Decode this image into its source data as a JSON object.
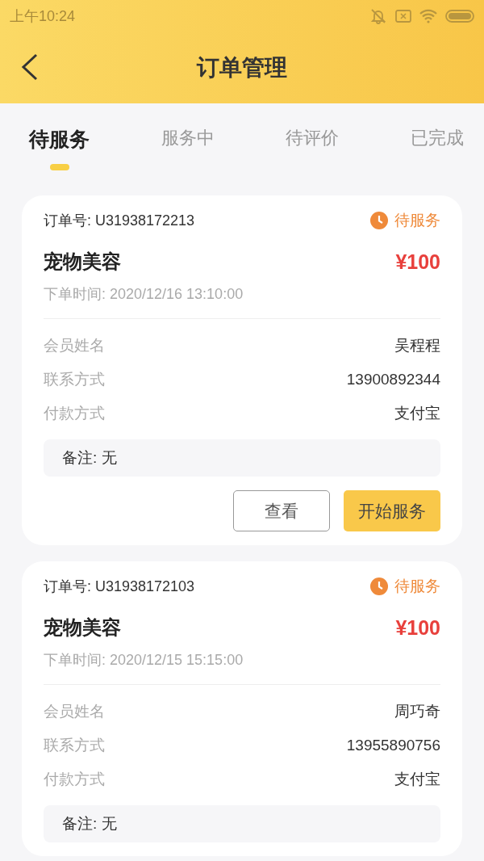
{
  "status_bar": {
    "time": "上午10:24"
  },
  "header": {
    "title": "订单管理"
  },
  "tabs": [
    {
      "label": "待服务",
      "selected": true
    },
    {
      "label": "服务中",
      "selected": false
    },
    {
      "label": "待评价",
      "selected": false
    },
    {
      "label": "已完成",
      "selected": false
    }
  ],
  "orders": [
    {
      "order_no": "订单号: U31938172213",
      "status": "待服务",
      "service": "宠物美容",
      "price": "¥100",
      "time": "下单时间: 2020/12/16 13:10:00",
      "fields": [
        {
          "label": "会员姓名",
          "value": "吴程程"
        },
        {
          "label": "联系方式",
          "value": "13900892344"
        },
        {
          "label": "付款方式",
          "value": "支付宝"
        }
      ],
      "note": "备注: 无",
      "buttons": [
        {
          "label": "查看",
          "kind": "outline"
        },
        {
          "label": "开始服务",
          "kind": "primary"
        }
      ]
    },
    {
      "order_no": "订单号: U31938172103",
      "status": "待服务",
      "service": "宠物美容",
      "price": "¥100",
      "time": "下单时间: 2020/12/15 15:15:00",
      "fields": [
        {
          "label": "会员姓名",
          "value": "周巧奇"
        },
        {
          "label": "联系方式",
          "value": "13955890756"
        },
        {
          "label": "付款方式",
          "value": "支付宝"
        }
      ],
      "note": "备注: 无"
    }
  ]
}
